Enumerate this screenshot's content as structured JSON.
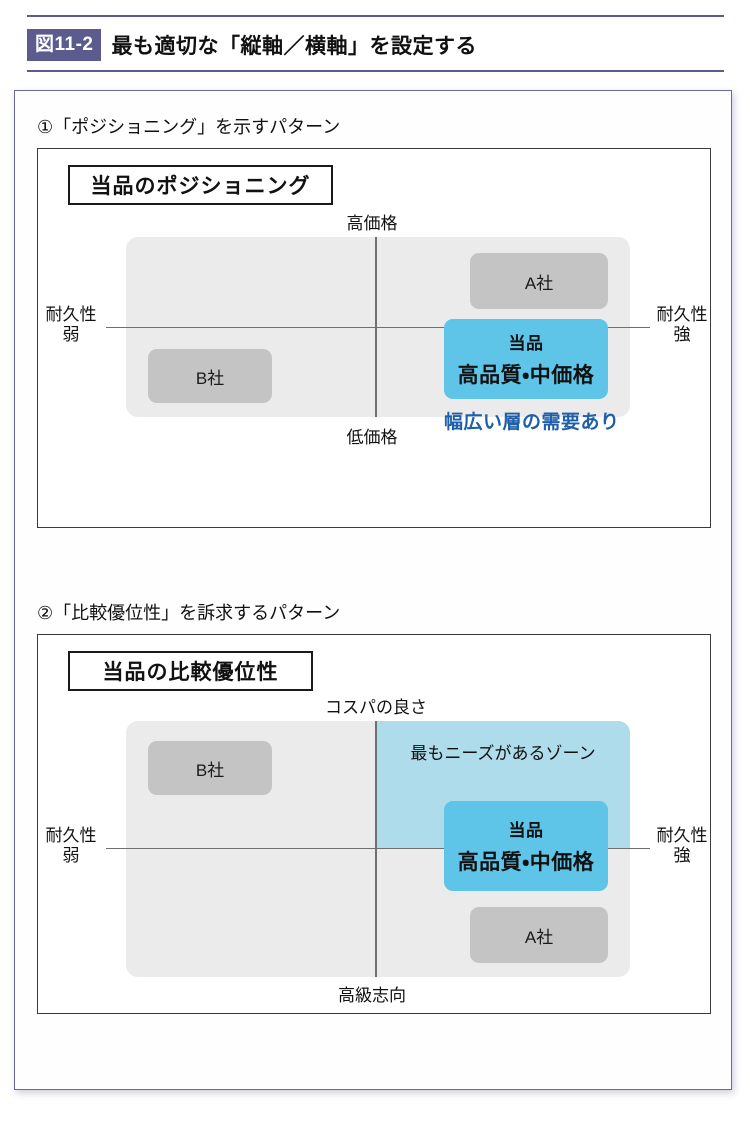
{
  "header": {
    "badge": "図11-2",
    "title": "最も適切な「縦軸／横軸」を設定する",
    "rule_color": "#5b5b8e",
    "badge_bg": "#5b5b8e"
  },
  "sections": [
    {
      "heading": "①「ポジショニング」を示すパターン",
      "panel_title": "当品のポジショニング",
      "axis": {
        "top": "高価格",
        "bottom": "低価格",
        "left_line1": "耐久性",
        "left_line2": "弱",
        "right_line1": "耐久性",
        "right_line2": "強"
      },
      "items": [
        {
          "label": "A社",
          "kind": "gray"
        },
        {
          "label": "B社",
          "kind": "gray"
        }
      ],
      "highlight": {
        "line1": "当品",
        "line2": "高品質・中価格",
        "color": "#5ec5e8"
      },
      "note": "幅広い層の需要あり",
      "note_color": "#1f5fa8"
    },
    {
      "heading": "②「比較優位性」を訴求するパターン",
      "panel_title": "当品の比較優位性",
      "axis": {
        "top": "コスパの良さ",
        "bottom": "高級志向",
        "left_line1": "耐久性",
        "left_line2": "弱",
        "right_line1": "耐久性",
        "right_line2": "強"
      },
      "items": [
        {
          "label": "B社",
          "kind": "gray"
        },
        {
          "label": "A社",
          "kind": "gray"
        }
      ],
      "zone_label": "最もニーズがあるゾーン",
      "zone_color": "#aedcea",
      "highlight": {
        "line1": "当品",
        "line2": "高品質・中価格",
        "color": "#5ec5e8"
      }
    }
  ],
  "chart_data": [
    {
      "type": "scatter",
      "title": "当品のポジショニング",
      "xlabel": "耐久性（弱 → 強）",
      "ylabel": "価格（低価格 → 高価格）",
      "axis_labels": {
        "top": "高価格",
        "bottom": "低価格",
        "left": "耐久性 弱",
        "right": "耐久性 強"
      },
      "xlim": [
        -1,
        1
      ],
      "ylim": [
        -1,
        1
      ],
      "grid": false,
      "points": [
        {
          "name": "A社",
          "x": 0.55,
          "y": 0.62,
          "style": "gray-box"
        },
        {
          "name": "B社",
          "x": -0.55,
          "y": -0.5,
          "style": "gray-box"
        },
        {
          "name": "当品 高品質・中価格",
          "x": 0.52,
          "y": 0.1,
          "style": "blue-box"
        }
      ],
      "annotations": [
        {
          "text": "幅広い層の需要あり",
          "x": 0.52,
          "y": -0.28,
          "color": "#1f5fa8"
        }
      ]
    },
    {
      "type": "scatter",
      "title": "当品の比較優位性",
      "xlabel": "耐久性（弱 → 強）",
      "ylabel": "志向（高級志向 → コスパの良さ）",
      "axis_labels": {
        "top": "コスパの良さ",
        "bottom": "高級志向",
        "left": "耐久性 弱",
        "right": "耐久性 強"
      },
      "xlim": [
        -1,
        1
      ],
      "ylim": [
        -1,
        1
      ],
      "grid": false,
      "points": [
        {
          "name": "B社",
          "x": -0.55,
          "y": 0.62,
          "style": "gray-box"
        },
        {
          "name": "A社",
          "x": 0.55,
          "y": -0.58,
          "style": "gray-box"
        },
        {
          "name": "当品 高品質・中価格",
          "x": 0.52,
          "y": 0.05,
          "style": "blue-box"
        }
      ],
      "regions": [
        {
          "label": "最もニーズがあるゾーン",
          "x_range": [
            0,
            1
          ],
          "y_range": [
            0,
            1
          ],
          "color": "#aedcea"
        }
      ]
    }
  ]
}
